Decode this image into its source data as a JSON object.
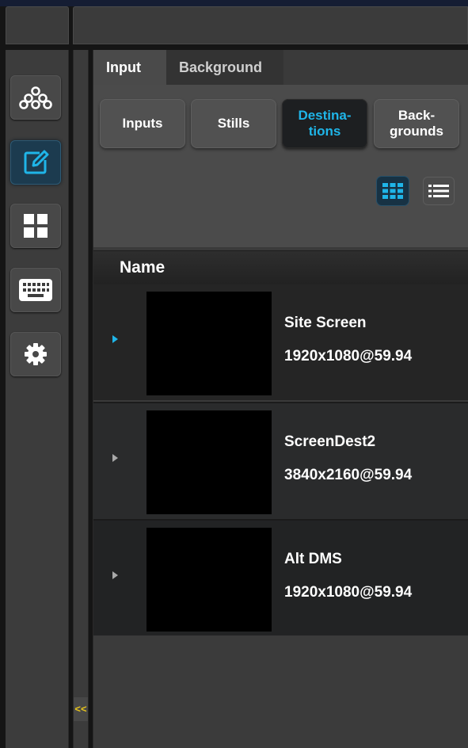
{
  "tabs": [
    {
      "label": "Input",
      "active": true
    },
    {
      "label": "Background",
      "active": false
    }
  ],
  "sub_buttons": [
    {
      "label": "Inputs",
      "active": false
    },
    {
      "label": "Stills",
      "active": false
    },
    {
      "label": "Destina-\ntions",
      "active": true
    },
    {
      "label": "Back-\ngrounds",
      "active": false
    }
  ],
  "sidebar": {
    "items": [
      {
        "icon": "network-nodes-icon",
        "active": false
      },
      {
        "icon": "edit-icon",
        "active": true
      },
      {
        "icon": "layout-grid-icon",
        "active": false
      },
      {
        "icon": "keyboard-icon",
        "active": false
      },
      {
        "icon": "gear-icon",
        "active": false
      }
    ],
    "collapse_label": "<<"
  },
  "view_toggle": {
    "grid_icon": "grid-view-icon",
    "list_icon": "list-view-icon",
    "selected": "grid"
  },
  "table": {
    "header": "Name",
    "rows": [
      {
        "name": "Site Screen",
        "resolution": "1920x1080@59.94",
        "selected": true
      },
      {
        "name": "ScreenDest2",
        "resolution": "3840x2160@59.94",
        "selected": false
      },
      {
        "name": "Alt DMS",
        "resolution": "1920x1080@59.94",
        "selected": false
      }
    ]
  },
  "colors": {
    "accent": "#1fb5e8",
    "collapse_arrow": "#e6c31c",
    "active_bg": "#1c3b4f"
  }
}
